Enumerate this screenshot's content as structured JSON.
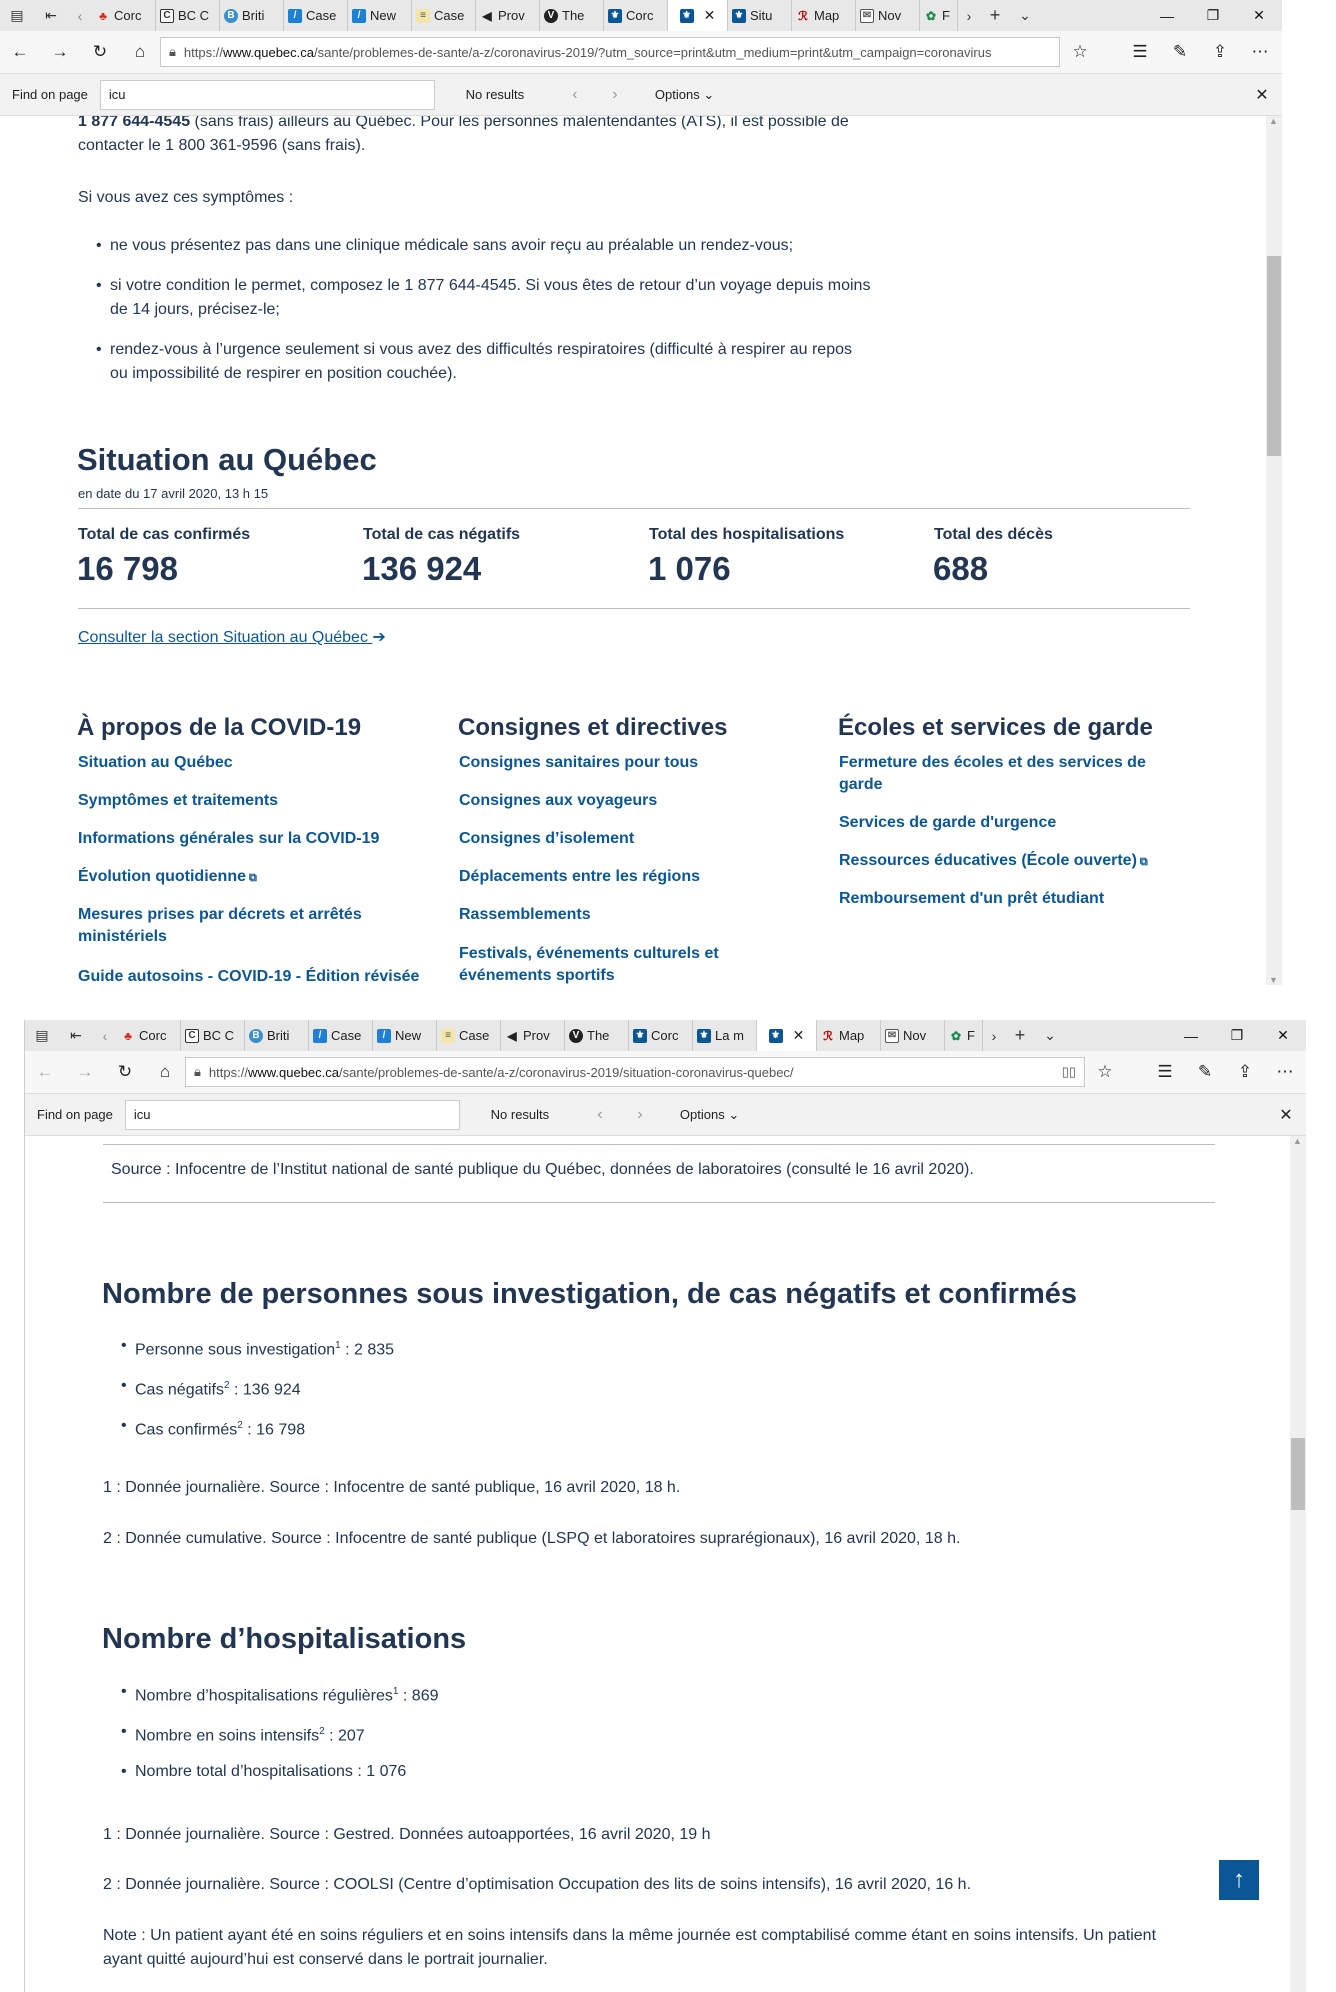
{
  "browser": {
    "find_label": "Find on page",
    "find_query": "icu",
    "find_result": "No results",
    "find_options": "Options"
  },
  "window1": {
    "tabs": [
      "Corc",
      "BC C",
      "Briti",
      "Case",
      "New",
      "Case",
      "Prov",
      "The",
      "Corc",
      "",
      "Situ",
      "Map",
      "Nov",
      "F"
    ],
    "url_prefix": "https://",
    "url_domain": "www.quebec.ca",
    "url_path": "/sante/problemes-de-sante/a-z/coronavirus-2019/?utm_source=print&utm_medium=print&utm_campaign=coronavirus",
    "content": {
      "phone_bold": "1 877 644-4545",
      "phone_rest": " (sans frais) ailleurs au Québec. Pour les personnes malentendantes (ATS), il est possible de",
      "phone_line2": "contacter le 1 800 361-9596 (sans frais).",
      "symptoms_intro": "Si vous avez ces symptômes :",
      "bullets": [
        "ne vous présentez pas dans une clinique médicale sans avoir reçu au préalable un rendez-vous;",
        "si votre condition le permet, composez le 1 877 644-4545. Si vous êtes de retour d’un voyage depuis moins",
        "de 14 jours, précisez-le;",
        "rendez-vous à l’urgence seulement si vous avez des difficultés respiratoires (difficulté à respirer au repos",
        "ou impossibilité de respirer en position couchée)."
      ],
      "situation_title": "Situation au Québec",
      "situation_date": "en date du 17 avril 2020, 13 h 15",
      "stats": [
        {
          "label": "Total de cas confirmés",
          "value": "16 798"
        },
        {
          "label": "Total de cas négatifs",
          "value": "136 924"
        },
        {
          "label": "Total des hospitalisations",
          "value": "1 076"
        },
        {
          "label": "Total des décès",
          "value": "688"
        }
      ],
      "consult_link": "Consulter la section Situation au Québec",
      "columns": [
        {
          "title": "À propos de la COVID-19",
          "links": [
            "Situation au Québec",
            "Symptômes et traitements",
            "Informations générales sur la COVID-19",
            "Évolution quotidienne",
            "Mesures prises par décrets et arrêtés",
            "ministériels",
            "Guide autosoins - COVID-19 - Édition révisée"
          ]
        },
        {
          "title": "Consignes et directives",
          "links": [
            "Consignes sanitaires pour tous",
            "Consignes aux voyageurs",
            "Consignes d’isolement",
            "Déplacements entre les régions",
            "Rassemblements",
            "Festivals, événements culturels et",
            "événements sportifs"
          ]
        },
        {
          "title": "Écoles et services de garde",
          "links": [
            "Fermeture des écoles et des services de",
            "garde",
            "Services de garde d'urgence",
            "Ressources éducatives (École ouverte)",
            "Remboursement d'un prêt étudiant"
          ]
        }
      ]
    }
  },
  "window2": {
    "tabs": [
      "Corc",
      "BC C",
      "Briti",
      "Case",
      "New",
      "Case",
      "Prov",
      "The",
      "Corc",
      "La m",
      "",
      "Map",
      "Nov",
      "F"
    ],
    "url_prefix": "https://",
    "url_domain": "www.quebec.ca",
    "url_path": "/sante/problemes-de-sante/a-z/coronavirus-2019/situation-coronavirus-quebec/",
    "content": {
      "source_line": "Source : Infocentre de l’Institut national de santé publique du Québec, données de laboratoires (consulté le 16 avril 2020).",
      "section1_title": "Nombre de personnes sous investigation, de cas négatifs et confirmés",
      "section1_items": [
        {
          "label": "Personne sous investigation",
          "sup": "1",
          "value": " : 2 835"
        },
        {
          "label": "Cas négatifs",
          "sup": "2",
          "value": " : 136 924"
        },
        {
          "label": "Cas confirmés",
          "sup": "2",
          "value": " : 16 798"
        }
      ],
      "note1": "1 : Donnée journalière. Source : Infocentre de santé publique, 16 avril 2020, 18 h.",
      "note2": "2 : Donnée cumulative. Source : Infocentre de santé publique (LSPQ et laboratoires suprarégionaux), 16 avril 2020, 18 h.",
      "section2_title": "Nombre d’hospitalisations",
      "section2_items": [
        {
          "label": "Nombre d’hospitalisations régulières",
          "sup": "1",
          "value": " : 869"
        },
        {
          "label": "Nombre en soins intensifs",
          "sup": "2",
          "value": " : 207"
        },
        {
          "label": "Nombre total d’hospitalisations",
          "sup": "",
          "value": " : 1 076"
        }
      ],
      "note3": "1 : Donnée journalière. Source : Gestred. Données autoapportées, 16 avril 2020, 19 h",
      "note4": "2 : Donnée journalière. Source : COOLSI (Centre d’optimisation Occupation des lits de soins intensifs), 16 avril 2020, 16 h.",
      "note5a": "Note : Un patient ayant été en soins réguliers et en soins intensifs dans la même journée est comptabilisé comme étant en soins intensifs. Un patient",
      "note5b": "ayant quitté aujourd’hui est conservé dans le portrait journalier."
    }
  }
}
